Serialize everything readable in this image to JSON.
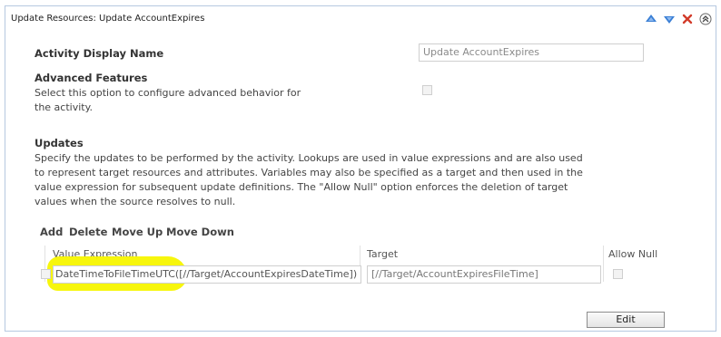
{
  "panel": {
    "title": "Update Resources: Update AccountExpires",
    "icons": [
      "move-up-icon",
      "move-down-icon",
      "delete-icon",
      "collapse-icon"
    ]
  },
  "activity_display_name": {
    "label": "Activity Display Name",
    "value": "Update AccountExpires"
  },
  "advanced_features": {
    "label": "Advanced Features",
    "description": "Select this option to configure advanced behavior for the activity.",
    "checked": false
  },
  "updates": {
    "label": "Updates",
    "description": "Specify the updates to be performed by the activity. Lookups are used in value expressions and are also used to represent target resources and attributes. Variables may also be specified as a target and then used in the value expression for subsequent update definitions. The \"Allow Null\" option enforces the deletion of target values when the source resolves to null.",
    "toolbar": {
      "add": "Add",
      "delete": "Delete",
      "move_up": "Move Up",
      "move_down": "Move Down"
    },
    "columns": {
      "value_expression": "Value Expression",
      "target": "Target",
      "allow_null": "Allow Null"
    },
    "rows": [
      {
        "selected": false,
        "value_expression": "DateTimeToFileTimeUTC([//Target/AccountExpiresDateTime])",
        "target": "[//Target/AccountExpiresFileTime]",
        "allow_null": false
      }
    ]
  },
  "edit_button": "Edit",
  "colors": {
    "panel_border": "#b6c8e0",
    "arrow_blue": "#3a7fd5",
    "delete_red": "#d23c2a",
    "highlight": "#f7f500"
  }
}
